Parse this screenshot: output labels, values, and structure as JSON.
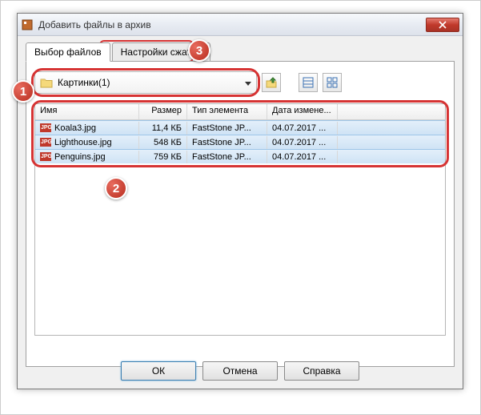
{
  "window": {
    "title": "Добавить файлы в архив"
  },
  "tabs": {
    "files": "Выбор файлов",
    "compress": "Настройки сжатия"
  },
  "folder": {
    "selected": "Картинки(1)"
  },
  "columns": {
    "name": "Имя",
    "size": "Размер",
    "type": "Тип элемента",
    "date": "Дата измене..."
  },
  "files": [
    {
      "name": "Koala3.jpg",
      "size": "11,4 КБ",
      "type": "FastStone JP...",
      "date": "04.07.2017 ..."
    },
    {
      "name": "Lighthouse.jpg",
      "size": "548 КБ",
      "type": "FastStone JP...",
      "date": "04.07.2017 ..."
    },
    {
      "name": "Penguins.jpg",
      "size": "759 КБ",
      "type": "FastStone JP...",
      "date": "04.07.2017 ..."
    }
  ],
  "buttons": {
    "ok": "ОК",
    "cancel": "Отмена",
    "help": "Справка"
  },
  "markers": {
    "m1": "1",
    "m2": "2",
    "m3": "3"
  },
  "icons": {
    "jpg": "JPG"
  }
}
